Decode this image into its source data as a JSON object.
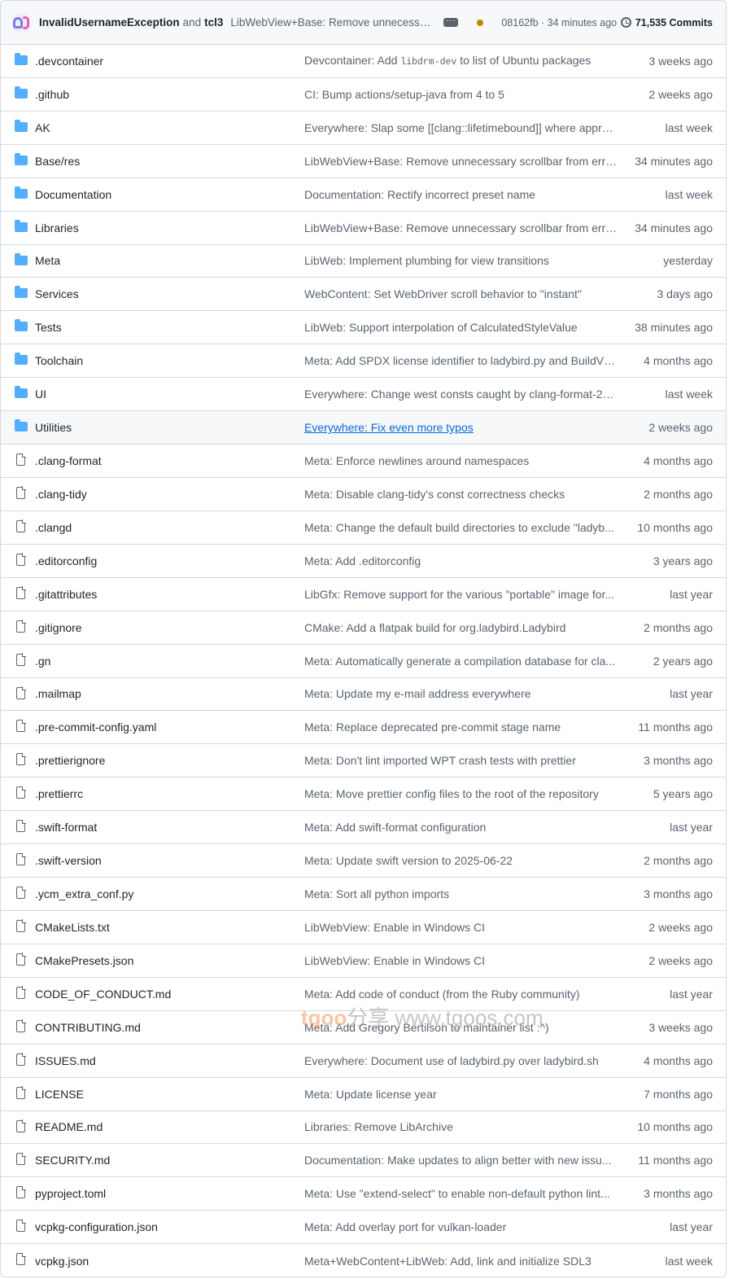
{
  "header": {
    "author_primary": "InvalidUsernameException",
    "and_text": "and",
    "author_secondary": "tcl3",
    "commit_message": "LibWebView+Base: Remove unnecessa...",
    "sha_time": "08162fb · 34 minutes ago",
    "commits_label": "71,535 Commits"
  },
  "colors": {
    "folder": "#54aeff",
    "link": "#0969da",
    "status_dot": "#bf8700"
  },
  "rows": [
    {
      "type": "folder",
      "name": ".devcontainer",
      "msg_pre": "Devcontainer: Add ",
      "msg_code": "libdrm-dev",
      "msg_post": " to list of Ubuntu packages",
      "age": "3 weeks ago"
    },
    {
      "type": "folder",
      "name": ".github",
      "msg": "CI: Bump actions/setup-java from 4 to 5",
      "age": "2 weeks ago"
    },
    {
      "type": "folder",
      "name": "AK",
      "msg": "Everywhere: Slap some [[clang::lifetimebound]] where appro...",
      "age": "last week"
    },
    {
      "type": "folder",
      "name": "Base/res",
      "msg": "LibWebView+Base: Remove unnecessary scrollbar from error...",
      "age": "34 minutes ago"
    },
    {
      "type": "folder",
      "name": "Documentation",
      "msg": "Documentation: Rectify incorrect preset name",
      "age": "last week"
    },
    {
      "type": "folder",
      "name": "Libraries",
      "msg": "LibWebView+Base: Remove unnecessary scrollbar from error...",
      "age": "34 minutes ago"
    },
    {
      "type": "folder",
      "name": "Meta",
      "msg": "LibWeb: Implement plumbing for view transitions",
      "age": "yesterday"
    },
    {
      "type": "folder",
      "name": "Services",
      "msg": "WebContent: Set WebDriver scroll behavior to \"instant\"",
      "age": "3 days ago"
    },
    {
      "type": "folder",
      "name": "Tests",
      "msg": "LibWeb: Support interpolation of CalculatedStyleValue",
      "age": "38 minutes ago"
    },
    {
      "type": "folder",
      "name": "Toolchain",
      "msg": "Meta: Add SPDX license identifier to ladybird.py and BuildVc...",
      "age": "4 months ago"
    },
    {
      "type": "folder",
      "name": "UI",
      "msg": "Everywhere: Change west consts caught by clang-format-21 ...",
      "age": "last week"
    },
    {
      "type": "folder",
      "name": "Utilities",
      "msg": "Everywhere: Fix even more typos",
      "age": "2 weeks ago",
      "hover": true
    },
    {
      "type": "file",
      "name": ".clang-format",
      "msg": "Meta: Enforce newlines around namespaces",
      "age": "4 months ago"
    },
    {
      "type": "file",
      "name": ".clang-tidy",
      "msg": "Meta: Disable clang-tidy's const correctness checks",
      "age": "2 months ago"
    },
    {
      "type": "file",
      "name": ".clangd",
      "msg": "Meta: Change the default build directories to exclude \"ladyb...",
      "age": "10 months ago"
    },
    {
      "type": "file",
      "name": ".editorconfig",
      "msg": "Meta: Add .editorconfig",
      "age": "3 years ago"
    },
    {
      "type": "file",
      "name": ".gitattributes",
      "msg": "LibGfx: Remove support for the various \"portable\" image for...",
      "age": "last year"
    },
    {
      "type": "file",
      "name": ".gitignore",
      "msg": "CMake: Add a flatpak build for org.ladybird.Ladybird",
      "age": "2 months ago"
    },
    {
      "type": "file",
      "name": ".gn",
      "msg": "Meta: Automatically generate a compilation database for cla...",
      "age": "2 years ago"
    },
    {
      "type": "file",
      "name": ".mailmap",
      "msg": "Meta: Update my e-mail address everywhere",
      "age": "last year"
    },
    {
      "type": "file",
      "name": ".pre-commit-config.yaml",
      "msg": "Meta: Replace deprecated pre-commit stage name",
      "age": "11 months ago"
    },
    {
      "type": "file",
      "name": ".prettierignore",
      "msg": "Meta: Don't lint imported WPT crash tests with prettier",
      "age": "3 months ago"
    },
    {
      "type": "file",
      "name": ".prettierrc",
      "msg": "Meta: Move prettier config files to the root of the repository",
      "age": "5 years ago"
    },
    {
      "type": "file",
      "name": ".swift-format",
      "msg": "Meta: Add swift-format configuration",
      "age": "last year"
    },
    {
      "type": "file",
      "name": ".swift-version",
      "msg": "Meta: Update swift version to 2025-06-22",
      "age": "2 months ago"
    },
    {
      "type": "file",
      "name": ".ycm_extra_conf.py",
      "msg": "Meta: Sort all python imports",
      "age": "3 months ago"
    },
    {
      "type": "file",
      "name": "CMakeLists.txt",
      "msg": "LibWebView: Enable in Windows CI",
      "age": "2 weeks ago"
    },
    {
      "type": "file",
      "name": "CMakePresets.json",
      "msg": "LibWebView: Enable in Windows CI",
      "age": "2 weeks ago"
    },
    {
      "type": "file",
      "name": "CODE_OF_CONDUCT.md",
      "msg": "Meta: Add code of conduct (from the Ruby community)",
      "age": "last year"
    },
    {
      "type": "file",
      "name": "CONTRIBUTING.md",
      "msg": "Meta: Add Gregory Bertilson to maintainer list :^)",
      "age": "3 weeks ago"
    },
    {
      "type": "file",
      "name": "ISSUES.md",
      "msg": "Everywhere: Document use of ladybird.py over ladybird.sh",
      "age": "4 months ago"
    },
    {
      "type": "file",
      "name": "LICENSE",
      "msg": "Meta: Update license year",
      "age": "7 months ago"
    },
    {
      "type": "file",
      "name": "README.md",
      "msg": "Libraries: Remove LibArchive",
      "age": "10 months ago"
    },
    {
      "type": "file",
      "name": "SECURITY.md",
      "msg": "Documentation: Make updates to align better with new issu...",
      "age": "11 months ago"
    },
    {
      "type": "file",
      "name": "pyproject.toml",
      "msg": "Meta: Use \"extend-select\" to enable non-default python lint...",
      "age": "3 months ago"
    },
    {
      "type": "file",
      "name": "vcpkg-configuration.json",
      "msg": "Meta: Add overlay port for vulkan-loader",
      "age": "last year"
    },
    {
      "type": "file",
      "name": "vcpkg.json",
      "msg": "Meta+WebContent+LibWeb: Add, link and initialize SDL3",
      "age": "last week"
    }
  ],
  "watermark": {
    "part1": "tgoo",
    "part2": "分享",
    "part3": "www.tgoos.com"
  }
}
